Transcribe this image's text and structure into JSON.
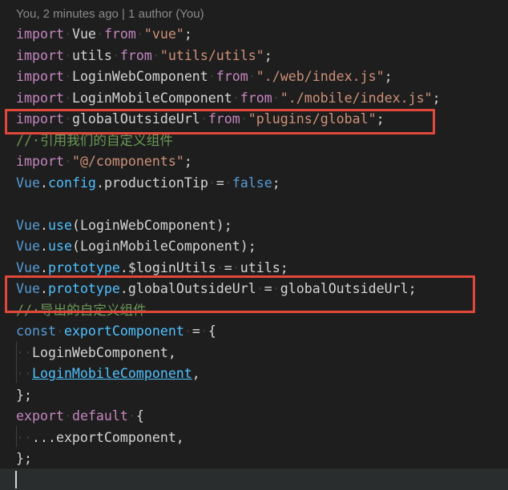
{
  "blame": "You, 2 minutes ago | 1 author (You)",
  "lines": [
    {
      "tokens": [
        {
          "text": "import",
          "cls": "kw-ctrl"
        },
        {
          "text": "·",
          "cls": "ws"
        },
        {
          "text": "Vue",
          "cls": "t"
        },
        {
          "text": "·",
          "cls": "ws"
        },
        {
          "text": "from",
          "cls": "kw-ctrl"
        },
        {
          "text": "·",
          "cls": "ws"
        },
        {
          "text": "\"vue\"",
          "cls": "str"
        },
        {
          "text": ";",
          "cls": "t"
        }
      ]
    },
    {
      "tokens": [
        {
          "text": "import",
          "cls": "kw-ctrl"
        },
        {
          "text": "·",
          "cls": "ws"
        },
        {
          "text": "utils",
          "cls": "t"
        },
        {
          "text": "·",
          "cls": "ws"
        },
        {
          "text": "from",
          "cls": "kw-ctrl"
        },
        {
          "text": "·",
          "cls": "ws"
        },
        {
          "text": "\"utils/utils\"",
          "cls": "str"
        },
        {
          "text": ";",
          "cls": "t"
        }
      ]
    },
    {
      "tokens": [
        {
          "text": "import",
          "cls": "kw-ctrl"
        },
        {
          "text": "·",
          "cls": "ws"
        },
        {
          "text": "LoginWebComponent",
          "cls": "t"
        },
        {
          "text": "·",
          "cls": "ws"
        },
        {
          "text": "from",
          "cls": "kw-ctrl"
        },
        {
          "text": "·",
          "cls": "ws"
        },
        {
          "text": "\"./web/index.js\"",
          "cls": "str"
        },
        {
          "text": ";",
          "cls": "t"
        }
      ]
    },
    {
      "tokens": [
        {
          "text": "import",
          "cls": "kw-ctrl"
        },
        {
          "text": "·",
          "cls": "ws"
        },
        {
          "text": "LoginMobileComponent",
          "cls": "t"
        },
        {
          "text": "·",
          "cls": "ws"
        },
        {
          "text": "from",
          "cls": "kw-ctrl"
        },
        {
          "text": "·",
          "cls": "ws"
        },
        {
          "text": "\"./mobile/index.js\"",
          "cls": "str"
        },
        {
          "text": ";",
          "cls": "t"
        }
      ]
    },
    {
      "tokens": [
        {
          "text": "import",
          "cls": "kw-ctrl"
        },
        {
          "text": "·",
          "cls": "ws"
        },
        {
          "text": "globalOutsideUrl",
          "cls": "t"
        },
        {
          "text": "·",
          "cls": "ws"
        },
        {
          "text": "from",
          "cls": "kw-ctrl"
        },
        {
          "text": "·",
          "cls": "ws"
        },
        {
          "text": "\"plugins/global\"",
          "cls": "str"
        },
        {
          "text": ";",
          "cls": "t"
        }
      ]
    },
    {
      "tokens": [
        {
          "text": "//·引用我们的自定义组件",
          "cls": "cmt"
        }
      ]
    },
    {
      "tokens": [
        {
          "text": "import",
          "cls": "kw-ctrl"
        },
        {
          "text": "·",
          "cls": "ws"
        },
        {
          "text": "\"@/components\"",
          "cls": "str"
        },
        {
          "text": ";",
          "cls": "t"
        }
      ]
    },
    {
      "tokens": [
        {
          "text": "Vue",
          "cls": "cls"
        },
        {
          "text": ".",
          "cls": "t"
        },
        {
          "text": "config",
          "cls": "prop"
        },
        {
          "text": ".",
          "cls": "t"
        },
        {
          "text": "productionTip",
          "cls": "t"
        },
        {
          "text": "·",
          "cls": "ws"
        },
        {
          "text": "=",
          "cls": "t"
        },
        {
          "text": "·",
          "cls": "ws"
        },
        {
          "text": "false",
          "cls": "kw-decl"
        },
        {
          "text": ";",
          "cls": "t"
        }
      ]
    },
    {
      "tokens": []
    },
    {
      "tokens": [
        {
          "text": "Vue",
          "cls": "cls"
        },
        {
          "text": ".",
          "cls": "t"
        },
        {
          "text": "use",
          "cls": "prop"
        },
        {
          "text": "(LoginWebComponent);",
          "cls": "t"
        }
      ]
    },
    {
      "tokens": [
        {
          "text": "Vue",
          "cls": "cls"
        },
        {
          "text": ".",
          "cls": "t"
        },
        {
          "text": "use",
          "cls": "prop"
        },
        {
          "text": "(LoginMobileComponent);",
          "cls": "t"
        }
      ]
    },
    {
      "tokens": [
        {
          "text": "Vue",
          "cls": "cls"
        },
        {
          "text": ".",
          "cls": "t"
        },
        {
          "text": "prototype",
          "cls": "prop"
        },
        {
          "text": ".$loginUtils",
          "cls": "t"
        },
        {
          "text": "·",
          "cls": "ws"
        },
        {
          "text": "=",
          "cls": "t"
        },
        {
          "text": "·",
          "cls": "ws"
        },
        {
          "text": "utils;",
          "cls": "t"
        }
      ]
    },
    {
      "tokens": [
        {
          "text": "Vue",
          "cls": "cls"
        },
        {
          "text": ".",
          "cls": "t"
        },
        {
          "text": "prototype",
          "cls": "prop"
        },
        {
          "text": ".globalOutsideUrl",
          "cls": "t"
        },
        {
          "text": "·",
          "cls": "ws"
        },
        {
          "text": "=",
          "cls": "t"
        },
        {
          "text": "·",
          "cls": "ws"
        },
        {
          "text": "globalOutsideUrl;",
          "cls": "t"
        }
      ]
    },
    {
      "tokens": [
        {
          "text": "//·导出的自定义组件",
          "cls": "cmt"
        }
      ]
    },
    {
      "tokens": [
        {
          "text": "const",
          "cls": "kw-decl"
        },
        {
          "text": "·",
          "cls": "ws"
        },
        {
          "text": "exportComponent",
          "cls": "prop"
        },
        {
          "text": "·",
          "cls": "ws"
        },
        {
          "text": "=",
          "cls": "t"
        },
        {
          "text": "·",
          "cls": "ws"
        },
        {
          "text": "{",
          "cls": "t"
        }
      ]
    },
    {
      "tokens": [
        {
          "text": "··",
          "cls": "ws"
        },
        {
          "text": "LoginWebComponent,",
          "cls": "t"
        }
      ]
    },
    {
      "tokens": [
        {
          "text": "··",
          "cls": "ws"
        },
        {
          "text": "LoginMobileComponent",
          "cls": "link"
        },
        {
          "text": ",",
          "cls": "t"
        }
      ]
    },
    {
      "tokens": [
        {
          "text": "};",
          "cls": "t"
        }
      ]
    },
    {
      "tokens": [
        {
          "text": "export",
          "cls": "kw-ctrl"
        },
        {
          "text": "·",
          "cls": "ws"
        },
        {
          "text": "default",
          "cls": "kw-ctrl"
        },
        {
          "text": "·",
          "cls": "ws"
        },
        {
          "text": "{",
          "cls": "t"
        }
      ]
    },
    {
      "tokens": [
        {
          "text": "··",
          "cls": "ws"
        },
        {
          "text": "...exportComponent,",
          "cls": "t"
        }
      ]
    },
    {
      "tokens": [
        {
          "text": "};",
          "cls": "t"
        }
      ]
    }
  ],
  "colors": {
    "background": "#1e1e1e",
    "highlight_box": "#e2483a",
    "keyword_control": "#c586c0",
    "keyword_decl": "#569cd6",
    "string": "#ce9178",
    "comment": "#6a9955",
    "property": "#4fc1ff"
  }
}
